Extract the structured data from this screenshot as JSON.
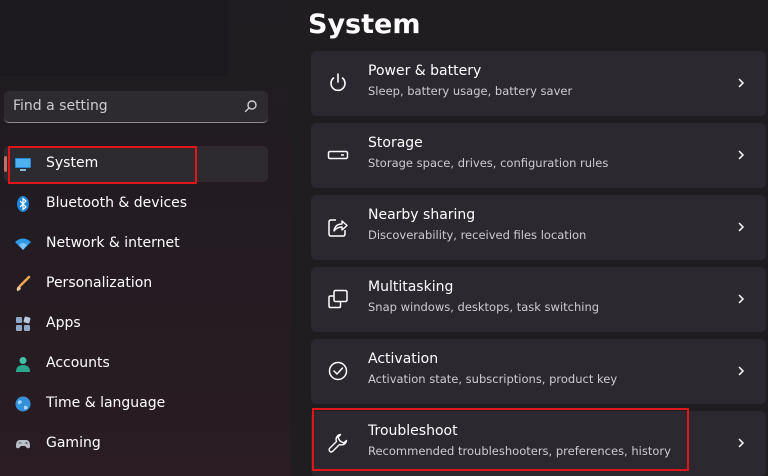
{
  "search": {
    "placeholder": "Find a setting",
    "icon": "search-icon"
  },
  "sidebar": {
    "items": [
      {
        "label": "System",
        "icon": "system-icon",
        "selected": true
      },
      {
        "label": "Bluetooth & devices",
        "icon": "bluetooth-icon"
      },
      {
        "label": "Network & internet",
        "icon": "wifi-icon"
      },
      {
        "label": "Personalization",
        "icon": "brush-icon"
      },
      {
        "label": "Apps",
        "icon": "apps-icon"
      },
      {
        "label": "Accounts",
        "icon": "accounts-icon"
      },
      {
        "label": "Time & language",
        "icon": "globe-icon"
      },
      {
        "label": "Gaming",
        "icon": "gaming-icon"
      }
    ]
  },
  "main": {
    "title": "System",
    "cards": [
      {
        "title": "Power & battery",
        "subtitle": "Sleep, battery usage, battery saver",
        "icon": "power-icon"
      },
      {
        "title": "Storage",
        "subtitle": "Storage space, drives, configuration rules",
        "icon": "storage-icon"
      },
      {
        "title": "Nearby sharing",
        "subtitle": "Discoverability, received files location",
        "icon": "share-icon"
      },
      {
        "title": "Multitasking",
        "subtitle": "Snap windows, desktops, task switching",
        "icon": "multitasking-icon"
      },
      {
        "title": "Activation",
        "subtitle": "Activation state, subscriptions, product key",
        "icon": "activation-icon"
      },
      {
        "title": "Troubleshoot",
        "subtitle": "Recommended troubleshooters, preferences, history",
        "icon": "wrench-icon"
      }
    ]
  },
  "colors": {
    "background": "#201d21",
    "card": "#2b2830",
    "accent": "#c46f63",
    "highlight": "#e0161b"
  }
}
